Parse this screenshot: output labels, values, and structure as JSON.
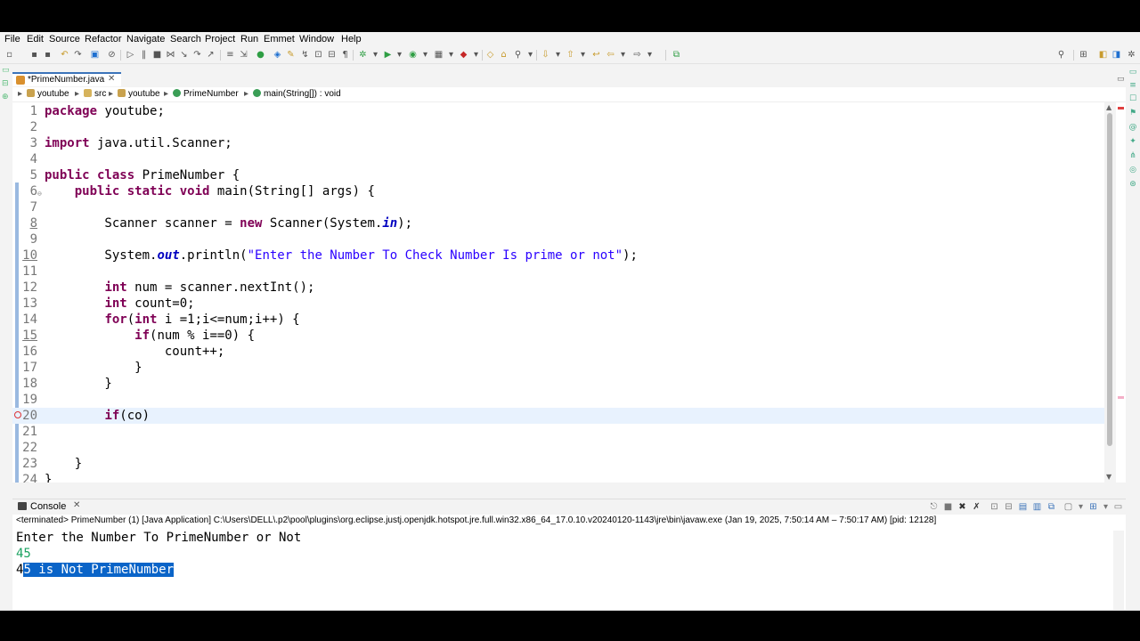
{
  "menu": [
    "File",
    "Edit",
    "Source",
    "Refactor",
    "Navigate",
    "Search",
    "Project",
    "Run",
    "Emmet",
    "Window",
    "Help"
  ],
  "editor": {
    "tab_label": "*PrimeNumber.java",
    "breadcrumb": [
      "youtube",
      "src",
      "youtube",
      "PrimeNumber",
      "main(String[]) : void"
    ]
  },
  "code": {
    "current_line": 20,
    "lines": [
      {
        "n": "1",
        "t": "package youtube;"
      },
      {
        "n": "2",
        "t": ""
      },
      {
        "n": "3",
        "t": "import java.util.Scanner;"
      },
      {
        "n": "4",
        "t": ""
      },
      {
        "n": "5",
        "t": "public class PrimeNumber {"
      },
      {
        "n": "6",
        "t": "    public static void main(String[] args) {"
      },
      {
        "n": "7",
        "t": ""
      },
      {
        "n": "8",
        "t": "        Scanner scanner = new Scanner(System.in);"
      },
      {
        "n": "9",
        "t": ""
      },
      {
        "n": "10",
        "t": "        System.out.println(\"Enter the Number To Check Number Is prime or not\");"
      },
      {
        "n": "11",
        "t": ""
      },
      {
        "n": "12",
        "t": "        int num = scanner.nextInt();"
      },
      {
        "n": "13",
        "t": "        int count=0;"
      },
      {
        "n": "14",
        "t": "        for(int i =1;i<=num;i++) {"
      },
      {
        "n": "15",
        "t": "            if(num % i==0) {"
      },
      {
        "n": "16",
        "t": "                count++;"
      },
      {
        "n": "17",
        "t": "            }"
      },
      {
        "n": "18",
        "t": "        }"
      },
      {
        "n": "19",
        "t": ""
      },
      {
        "n": "20",
        "t": "        if(co)"
      },
      {
        "n": "21",
        "t": ""
      },
      {
        "n": "22",
        "t": ""
      },
      {
        "n": "23",
        "t": "    }"
      },
      {
        "n": "24",
        "t": "}"
      }
    ]
  },
  "console": {
    "tab_label": "Console",
    "status": "<terminated> PrimeNumber (1) [Java Application] C:\\Users\\DELL\\.p2\\pool\\plugins\\org.eclipse.justj.openjdk.hotspot.jre.full.win32.x86_64_17.0.10.v20240120-1143\\jre\\bin\\javaw.exe  (Jan 19, 2025, 7:50:14 AM – 7:50:17 AM) [pid: 12128]",
    "output_prompt": "Enter the Number To PrimeNumber or Not",
    "input_value": "45",
    "result_first_char": "4",
    "result_selected": "5 is Not PrimeNumber"
  },
  "colors": {
    "keyword": "#7f0055",
    "string": "#2a00ff",
    "field": "#0000c0",
    "selection": "#0a64c8",
    "input": "#1aa260"
  }
}
